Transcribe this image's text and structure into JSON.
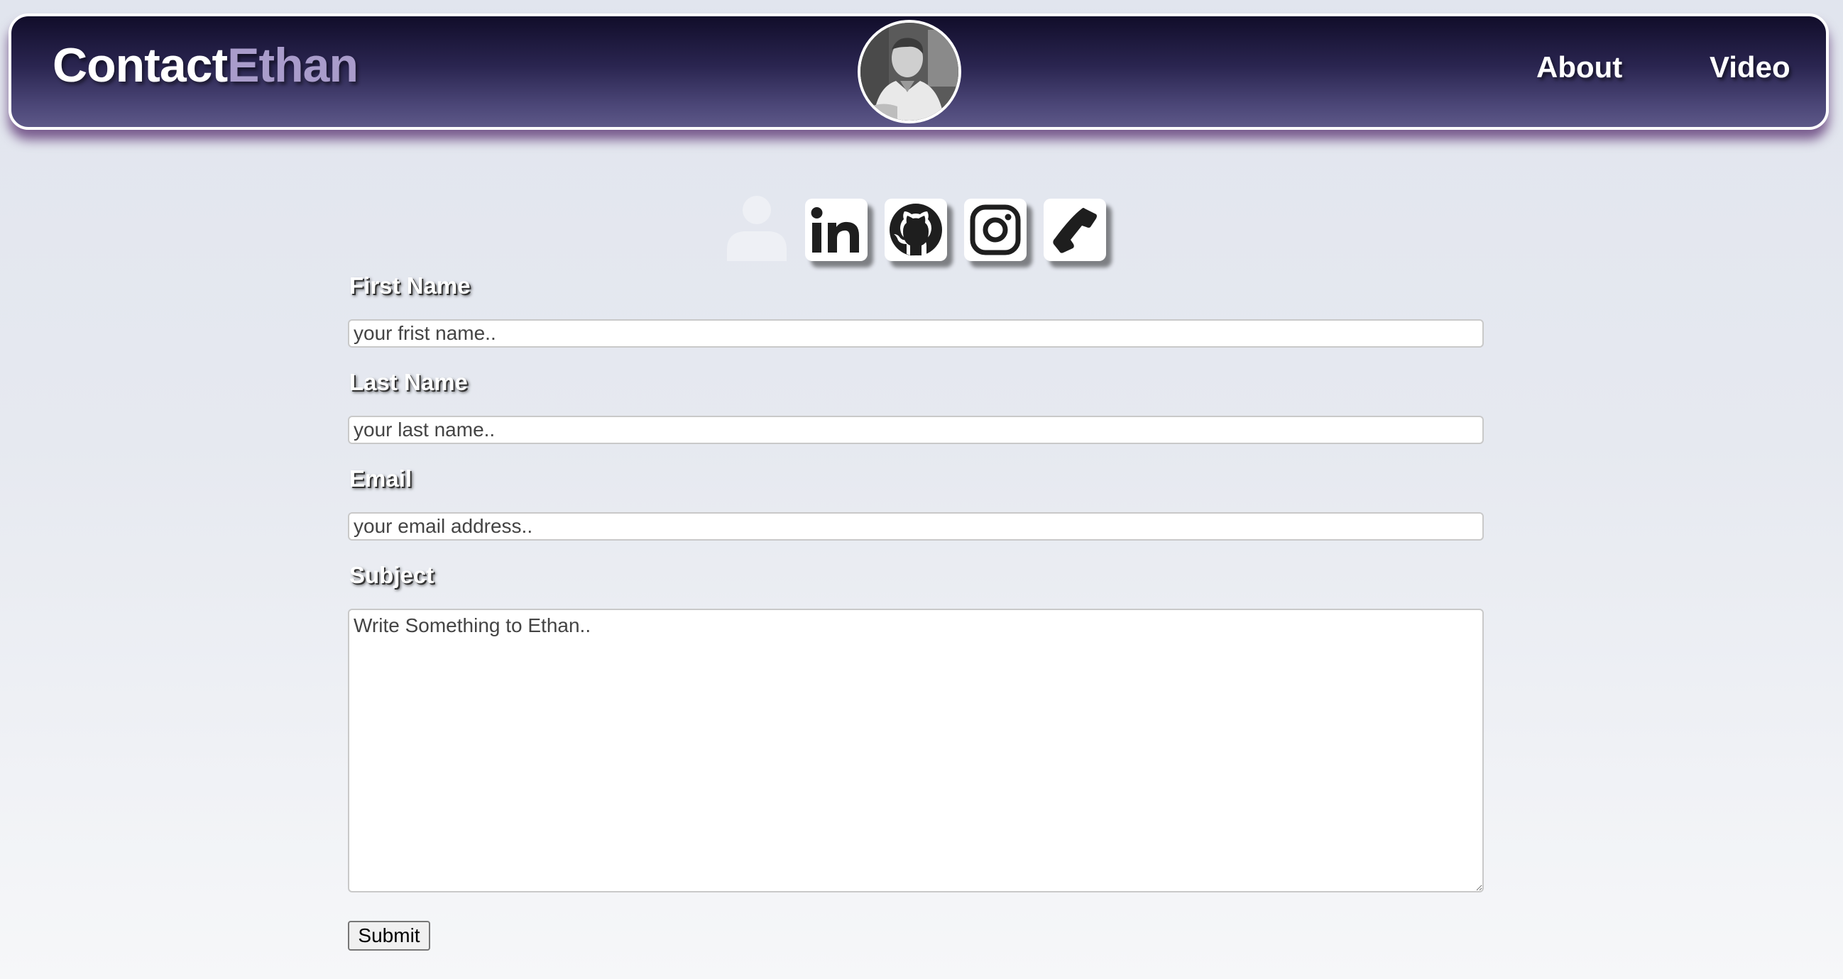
{
  "header": {
    "brand_part1": "Contact",
    "brand_part2": "Ethan",
    "avatar_alt": "Ethan profile photo",
    "nav": [
      {
        "label": "About"
      },
      {
        "label": "Video"
      }
    ]
  },
  "social": {
    "icons": [
      "person-icon",
      "linkedin-icon",
      "github-icon",
      "instagram-icon",
      "phone-icon"
    ]
  },
  "form": {
    "first_name": {
      "label": "First Name",
      "placeholder": "your frist name..",
      "value": ""
    },
    "last_name": {
      "label": "Last Name",
      "placeholder": "your last name..",
      "value": ""
    },
    "email": {
      "label": "Email",
      "placeholder": "your email address..",
      "value": ""
    },
    "subject": {
      "label": "Subject",
      "placeholder": "Write Something to Ethan..",
      "value": ""
    },
    "submit_label": "Submit"
  },
  "colors": {
    "header_dark": "#110d2a",
    "header_light": "#5d5888",
    "brand_accent": "#a99ccb",
    "shadow_purple": "#552d6e"
  }
}
